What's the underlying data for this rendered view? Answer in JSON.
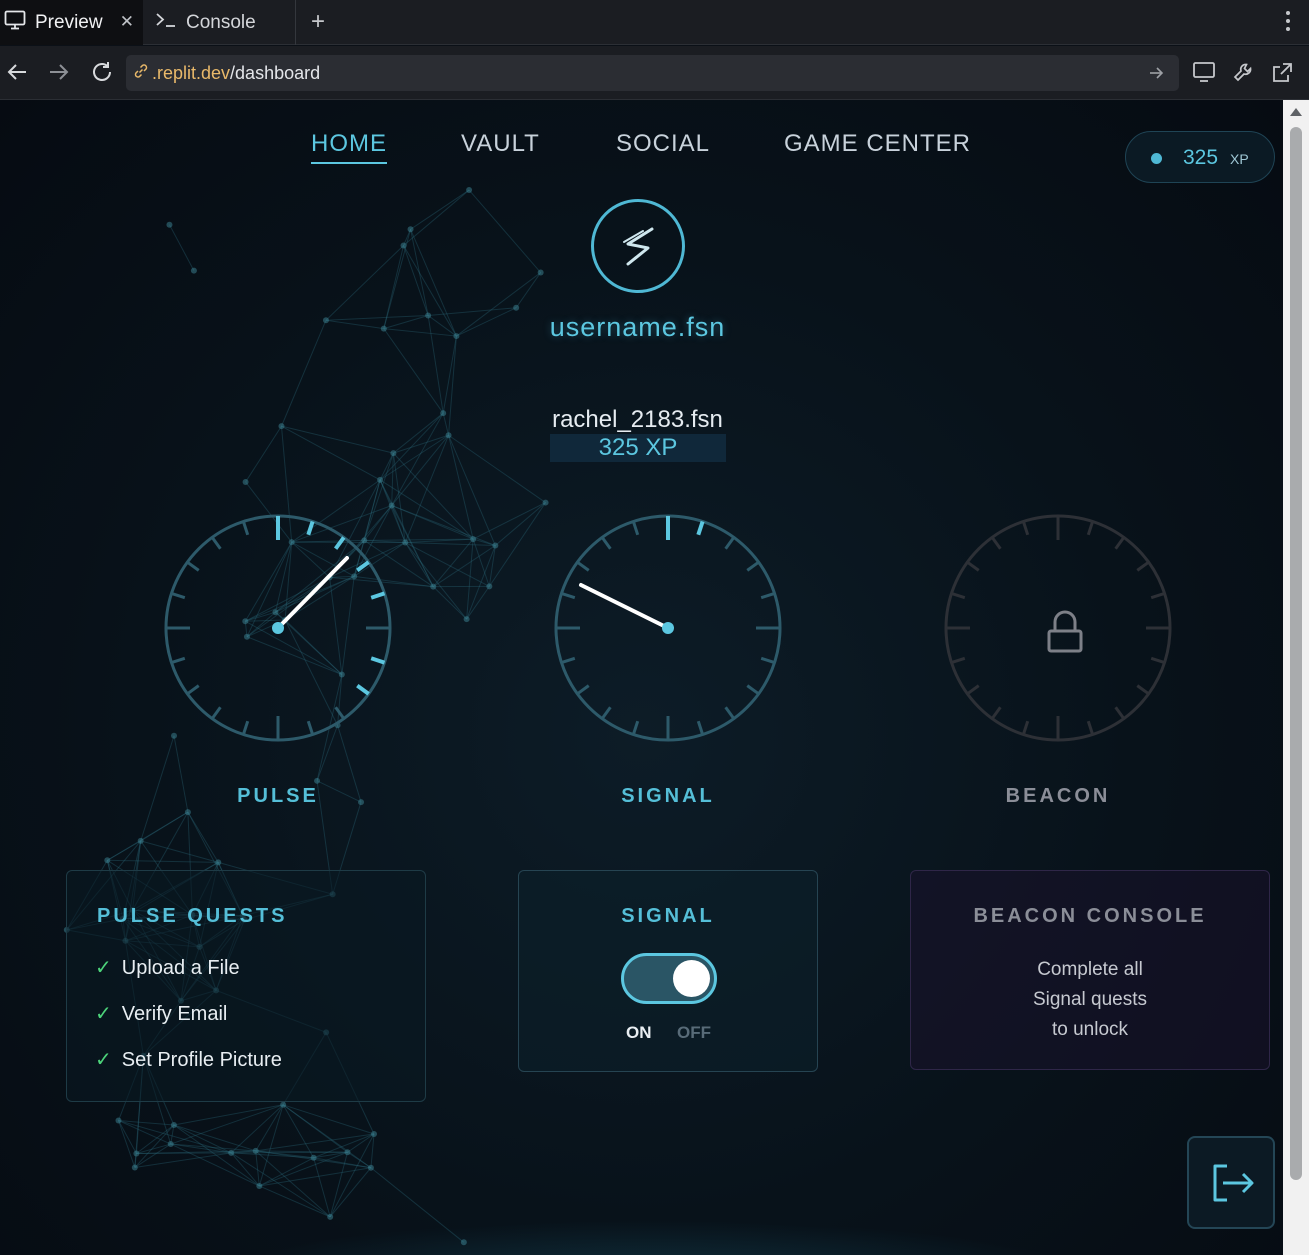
{
  "browser": {
    "tabs": [
      {
        "label": "Preview",
        "icon": "monitor-icon",
        "active": true
      },
      {
        "label": "Console",
        "icon": "terminal-icon",
        "active": false
      }
    ],
    "url": {
      "host": ".replit.dev",
      "path": "/dashboard"
    }
  },
  "nav": {
    "items": [
      "HOME",
      "VAULT",
      "SOCIAL",
      "GAME CENTER"
    ],
    "active": "HOME"
  },
  "xp_badge": {
    "value": "325",
    "unit": "XP"
  },
  "profile": {
    "brand": "username.fsn",
    "username": "rachel_2183.fsn",
    "xp_text": "325 XP"
  },
  "dials": [
    {
      "label": "PULSE",
      "state": "active",
      "color": "#55bfd8"
    },
    {
      "label": "SIGNAL",
      "state": "active",
      "color": "#55bfd8"
    },
    {
      "label": "BEACON",
      "state": "locked",
      "icon": "lock-icon",
      "color": "#8b8e98"
    }
  ],
  "pulse_quests": {
    "title": "PULSE QUESTS",
    "items": [
      {
        "label": "Upload a File",
        "done": true
      },
      {
        "label": "Verify Email",
        "done": true
      },
      {
        "label": "Set Profile Picture",
        "done": true
      }
    ]
  },
  "signal_card": {
    "title": "SIGNAL",
    "on_label": "ON",
    "off_label": "OFF",
    "toggle_on": true
  },
  "beacon_console": {
    "title": "BEACON CONSOLE",
    "lines": [
      "Complete all",
      "Signal quests",
      "to unlock"
    ]
  },
  "colors": {
    "accent": "#5cc7e0",
    "check": "#4cd37a",
    "background": "#08121a"
  }
}
